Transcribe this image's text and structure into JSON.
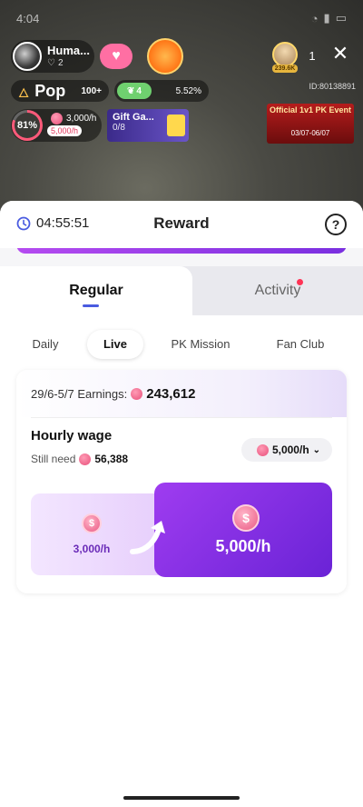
{
  "status_bar": {
    "time": "4:04"
  },
  "host": {
    "name": "Huma...",
    "likes": "2"
  },
  "viewers": {
    "tag": "239.6K",
    "count": "1"
  },
  "popularity": {
    "label": "Pop",
    "rank": "100+"
  },
  "level": {
    "value": "4",
    "percent": "5.52%"
  },
  "host_id": "ID:80138891",
  "goal": {
    "percent_label": "81%",
    "percent": 81,
    "rate": "3,000/h",
    "target": "5,000/h"
  },
  "gift_card": {
    "title": "Gift Ga...",
    "progress": "0/8"
  },
  "pk_banner": {
    "title": "Official 1v1 PK Event",
    "dates": "03/07-06/07"
  },
  "sheet": {
    "timer": "04:55:51",
    "title": "Reward",
    "help": "?"
  },
  "tabs": [
    {
      "label": "Regular",
      "active": true
    },
    {
      "label": "Activity",
      "active": false,
      "badge": true
    }
  ],
  "subtabs": [
    {
      "label": "Daily",
      "active": false
    },
    {
      "label": "Live",
      "active": true
    },
    {
      "label": "PK Mission",
      "active": false
    },
    {
      "label": "Fan Club",
      "active": false
    }
  ],
  "card": {
    "earnings_label": "29/6-5/7 Earnings:",
    "earnings_value": "243,612",
    "wage_title": "Hourly wage",
    "still_need_label": "Still need",
    "still_need_value": "56,388",
    "rate_selected": "5,000/h",
    "current_rate": "3,000/h",
    "target_rate": "5,000/h"
  },
  "colors": {
    "accent": "#4a5be0",
    "purple": "#7a2fe0",
    "coin": "#e84f7a"
  }
}
